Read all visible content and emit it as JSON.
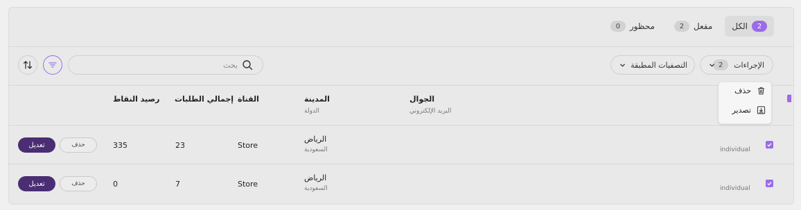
{
  "tabs": [
    {
      "label": "الكل",
      "count": "2"
    },
    {
      "label": "مفعل",
      "count": "2"
    },
    {
      "label": "محظور",
      "count": "0"
    }
  ],
  "toolbar": {
    "actions_label": "الإجراءات",
    "actions_count": "2",
    "applied_filters_label": "التصفيات المطبقة",
    "search_placeholder": "بحث"
  },
  "bulk_menu": {
    "delete_label": "حذف",
    "export_label": "تصدير"
  },
  "table": {
    "headers": {
      "mobile": "الجوال",
      "email": "البريد الإلكتروني",
      "city": "المدينة",
      "country": "الدولة",
      "channel": "القناة",
      "total_orders": "إجمالي الطلبات",
      "points_balance": "رصيد النقاط"
    },
    "rows": [
      {
        "type": "individual",
        "city": "الرياض",
        "country": "السعودية",
        "channel": "Store",
        "total_orders": "23",
        "points_balance": "335",
        "delete_label": "حذف",
        "edit_label": "تعديل"
      },
      {
        "type": "individual",
        "city": "الرياض",
        "country": "السعودية",
        "channel": "Store",
        "total_orders": "7",
        "points_balance": "0",
        "delete_label": "حذف",
        "edit_label": "تعديل"
      }
    ]
  },
  "colors": {
    "accent": "#9b6be8",
    "primary_button": "#4a2d73"
  }
}
